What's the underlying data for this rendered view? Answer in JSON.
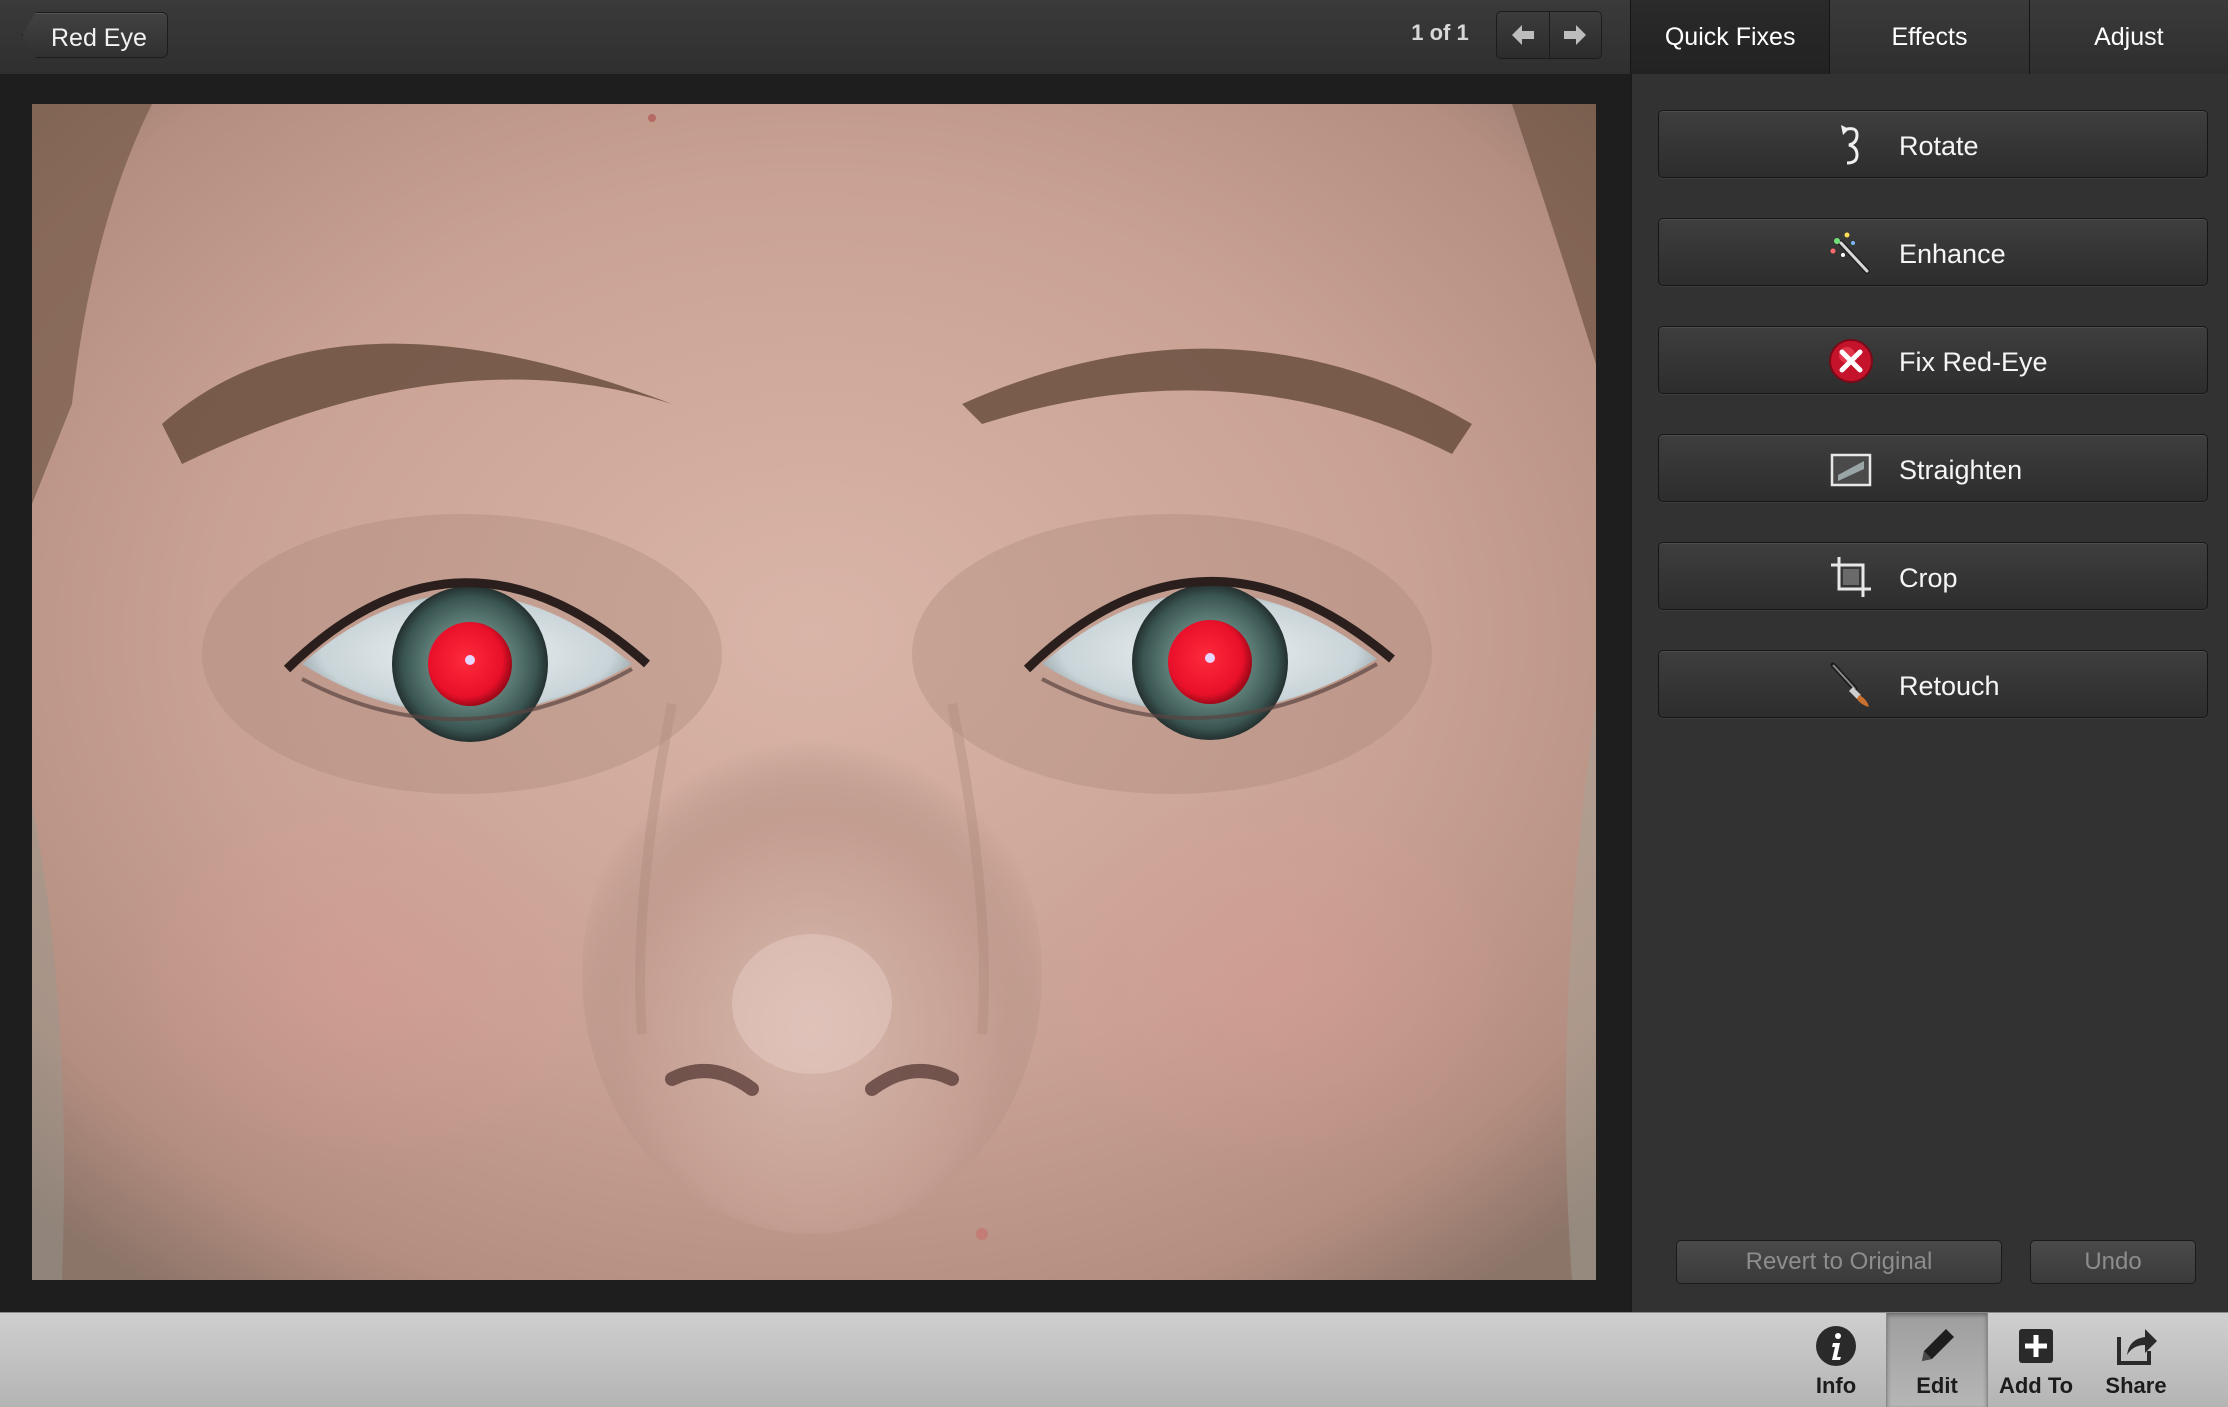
{
  "header": {
    "back_label": "Red Eye",
    "counter": "1 of 1",
    "prev_icon": "arrow-left-icon",
    "next_icon": "arrow-right-icon"
  },
  "tabs": [
    {
      "label": "Quick Fixes",
      "active": true
    },
    {
      "label": "Effects",
      "active": false
    },
    {
      "label": "Adjust",
      "active": false
    }
  ],
  "quick_fixes": [
    {
      "label": "Rotate",
      "icon": "rotate-icon"
    },
    {
      "label": "Enhance",
      "icon": "magic-wand-icon"
    },
    {
      "label": "Fix Red-Eye",
      "icon": "red-eye-icon"
    },
    {
      "label": "Straighten",
      "icon": "straighten-icon"
    },
    {
      "label": "Crop",
      "icon": "crop-icon"
    },
    {
      "label": "Retouch",
      "icon": "brush-icon"
    }
  ],
  "actions": {
    "revert": "Revert to Original",
    "undo": "Undo"
  },
  "toolbar": [
    {
      "label": "Info",
      "icon": "info-icon",
      "selected": false
    },
    {
      "label": "Edit",
      "icon": "pencil-icon",
      "selected": true
    },
    {
      "label": "Add To",
      "icon": "plus-box-icon",
      "selected": false
    },
    {
      "label": "Share",
      "icon": "share-icon",
      "selected": false
    }
  ],
  "colors": {
    "panel_bg": "#323232",
    "red_eye": "#e8102a",
    "iris": "#3d5f5c"
  }
}
